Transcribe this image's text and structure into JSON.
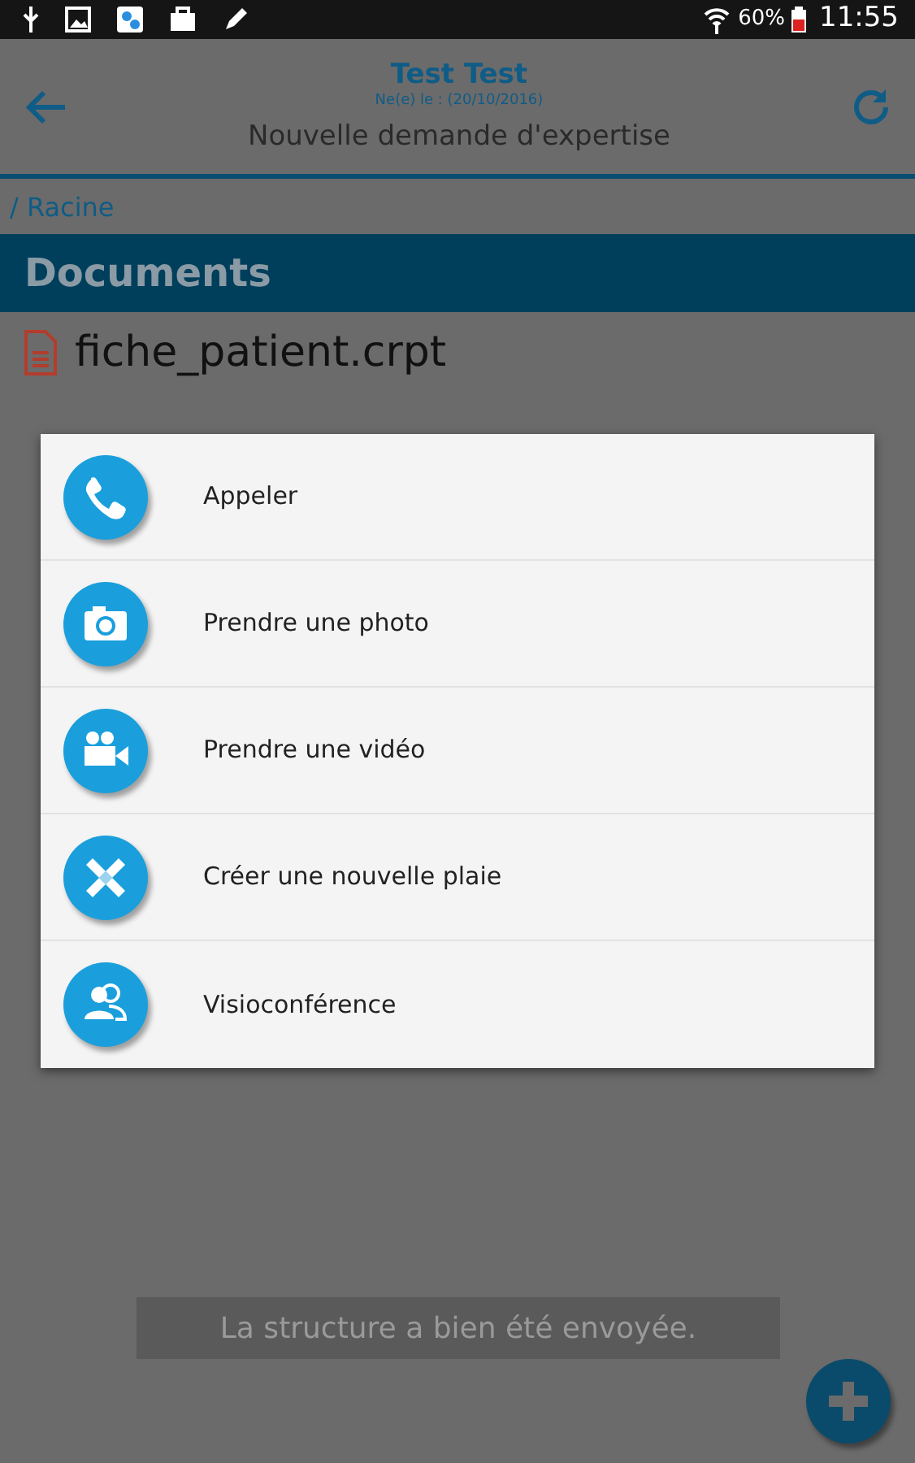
{
  "status_bar": {
    "battery": "60%",
    "time": "11:55"
  },
  "header": {
    "title": "Test Test",
    "subtitle": "Ne(e) le : (20/10/2016)",
    "heading": "Nouvelle demande d'expertise"
  },
  "breadcrumb": "/ Racine",
  "section": "Documents",
  "files": [
    {
      "name": "fiche_patient.crpt"
    }
  ],
  "dialog": {
    "items": [
      {
        "kind": "phone",
        "label": "Appeler"
      },
      {
        "kind": "camera",
        "label": "Prendre une photo"
      },
      {
        "kind": "video",
        "label": "Prendre une vidéo"
      },
      {
        "kind": "bandage",
        "label": "Créer une nouvelle plaie"
      },
      {
        "kind": "people",
        "label": "Visioconférence"
      }
    ]
  },
  "toast": "La structure a bien été envoyée."
}
